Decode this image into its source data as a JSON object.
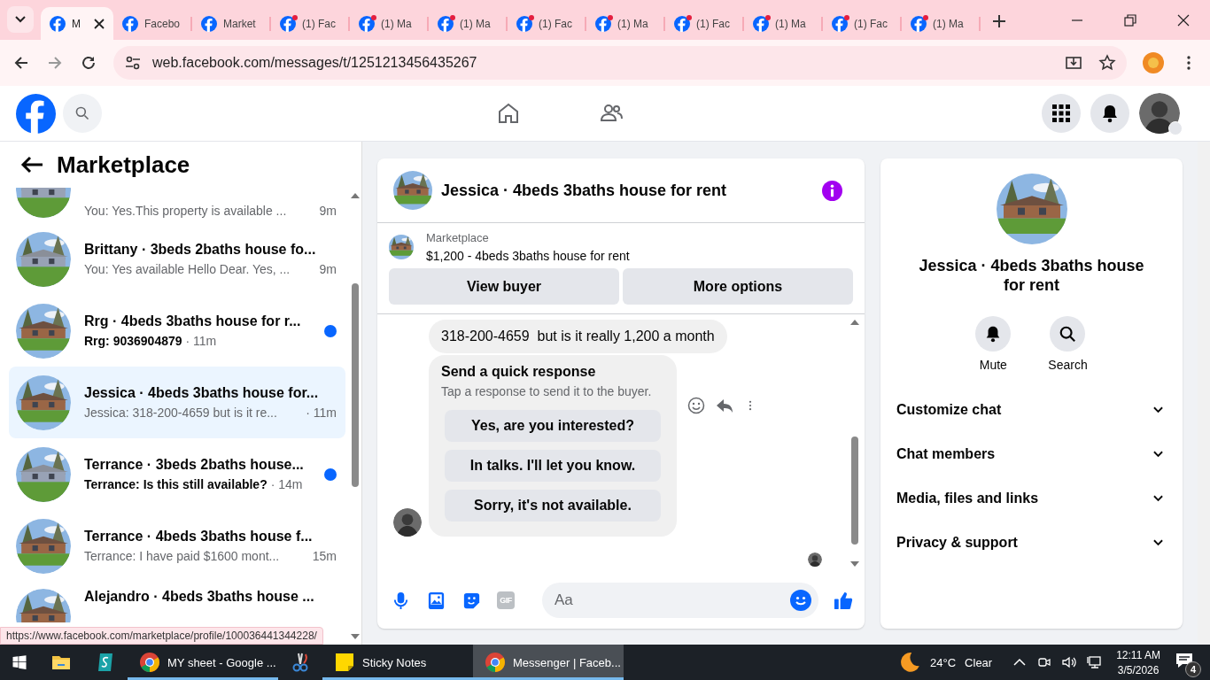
{
  "browser": {
    "tabs": [
      {
        "title": "M",
        "selected": true,
        "notification": false
      },
      {
        "title": "Facebo",
        "selected": false,
        "notification": false
      },
      {
        "title": "Market",
        "selected": false,
        "notification": false
      },
      {
        "title": "(1) Fac",
        "selected": false,
        "notification": true
      },
      {
        "title": "(1) Ma",
        "selected": false,
        "notification": true
      },
      {
        "title": "(1) Ma",
        "selected": false,
        "notification": true
      },
      {
        "title": "(1) Fac",
        "selected": false,
        "notification": true
      },
      {
        "title": "(1) Ma",
        "selected": false,
        "notification": true
      },
      {
        "title": "(1) Fac",
        "selected": false,
        "notification": true
      },
      {
        "title": "(1) Ma",
        "selected": false,
        "notification": true
      },
      {
        "title": "(1) Fac",
        "selected": false,
        "notification": true
      },
      {
        "title": "(1) Ma",
        "selected": false,
        "notification": true
      }
    ],
    "url": "web.facebook.com/messages/t/1251213456435267"
  },
  "sidebar": {
    "title": "Marketplace",
    "conversations": [
      {
        "kind": "partial",
        "preview": "You: Yes.This property is available ...",
        "time": "9m",
        "unread": false,
        "selected": false
      },
      {
        "kind": "full",
        "title": "Brittany · 3beds 2baths house fo...",
        "preview": "You: Yes available Hello Dear. Yes, ...",
        "time": "9m",
        "unread": false,
        "selected": false
      },
      {
        "kind": "full",
        "title": "Rrg · 4beds 3baths house for r...",
        "preview": "Rrg: 9036904879",
        "time": "· 11m",
        "unread": true,
        "selected": false
      },
      {
        "kind": "full",
        "title": "Jessica · 4beds 3baths house for...",
        "preview": "Jessica: 318-200-4659 but is it re...",
        "time": "· 11m",
        "unread": false,
        "selected": true
      },
      {
        "kind": "full",
        "title": "Terrance · 3beds 2baths house...",
        "preview": "Terrance: Is this still available?",
        "time": "· 14m",
        "unread": true,
        "selected": false
      },
      {
        "kind": "full",
        "title": "Terrance · 4beds 3baths house f...",
        "preview": "Terrance: I have paid $1600 mont...",
        "time": "15m",
        "unread": false,
        "selected": false
      },
      {
        "kind": "title_only",
        "title": "Alejandro · 4beds 3baths house ...",
        "unread": false,
        "selected": false
      }
    ]
  },
  "chat": {
    "title": "Jessica · 4beds 3baths house for rent",
    "listing": {
      "label": "Marketplace",
      "title": "$1,200 - 4beds 3baths house for rent"
    },
    "buttons": [
      "View buyer",
      "More options"
    ],
    "messages": [
      {
        "kind": "text",
        "text": "318-200-4659  but is it really 1,200 a month"
      },
      {
        "kind": "quick_response",
        "title": "Send a quick response",
        "subtitle": "Tap a response to send it to the buyer.",
        "options": [
          "Yes, are you interested?",
          "In talks. I'll let you know.",
          "Sorry, it's not available."
        ]
      }
    ],
    "composer": {
      "gif_label": "GIF",
      "placeholder": "Aa"
    }
  },
  "details": {
    "name": "Jessica · 4beds 3baths house for rent",
    "actions": [
      {
        "kind": "mute",
        "label": "Mute"
      },
      {
        "kind": "search",
        "label": "Search"
      }
    ],
    "sections": [
      {
        "label": "Customize chat",
        "expanded": false
      },
      {
        "label": "Chat members",
        "expanded": false
      },
      {
        "label": "Media, files and links",
        "expanded": false
      },
      {
        "label": "Privacy & support",
        "expanded": false
      }
    ]
  },
  "status_link": "https://www.facebook.com/marketplace/profile/100036441344228/",
  "taskbar": {
    "apps": [
      {
        "kind": "explorer",
        "running": false,
        "selected": false
      },
      {
        "kind": "vpn",
        "running": false,
        "selected": false
      },
      {
        "kind": "chrome",
        "label": "MY sheet - Google ...",
        "running": true,
        "selected": false
      },
      {
        "kind": "snip",
        "running": false,
        "selected": false
      },
      {
        "kind": "notes",
        "label": "Sticky Notes",
        "running": true,
        "selected": false
      },
      {
        "kind": "chrome",
        "label": "Messenger | Faceb...",
        "running": true,
        "selected": true
      }
    ],
    "weather": {
      "temp": "24°C",
      "condition": "Clear"
    },
    "time": "12:11 AM",
    "date": "3/5/2026",
    "notifications": "4"
  }
}
